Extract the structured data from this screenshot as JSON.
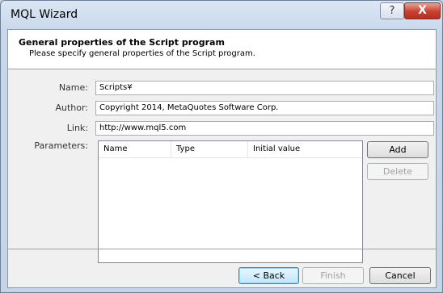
{
  "window": {
    "title": "MQL Wizard",
    "help_label": "?",
    "close_label": "X"
  },
  "header": {
    "title": "General properties of the Script program",
    "subtitle": "Please specify general properties of the Script program."
  },
  "form": {
    "name_label": "Name:",
    "name_value": "Scripts¥",
    "author_label": "Author:",
    "author_value": "Copyright 2014, MetaQuotes Software Corp.",
    "link_label": "Link:",
    "link_value": "http://www.mql5.com",
    "parameters_label": "Parameters:"
  },
  "parameters_table": {
    "columns": [
      "Name",
      "Type",
      "Initial value"
    ],
    "rows": []
  },
  "buttons": {
    "add": "Add",
    "delete": "Delete",
    "back": "< Back",
    "finish": "Finish",
    "cancel": "Cancel"
  }
}
